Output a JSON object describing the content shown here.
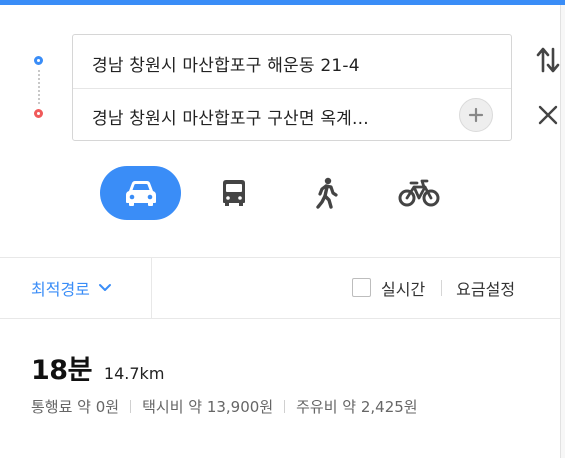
{
  "route": {
    "origin": "경남 창원시 마산합포구 해운동 21-4",
    "destination": "경남 창원시 마산합포구 구산면 옥계..."
  },
  "modes": [
    {
      "name": "car",
      "icon": "car-icon",
      "active": true
    },
    {
      "name": "bus",
      "icon": "bus-icon",
      "active": false
    },
    {
      "name": "walk",
      "icon": "walk-icon",
      "active": false
    },
    {
      "name": "bike",
      "icon": "bike-icon",
      "active": false
    }
  ],
  "options": {
    "route_preference": "최적경로",
    "realtime_label": "실시간",
    "fare_setting_label": "요금설정"
  },
  "result": {
    "duration": "18분",
    "distance": "14.7km",
    "toll": "통행료 약 0원",
    "taxi": "택시비 약 13,900원",
    "fuel": "주유비 약 2,425원"
  },
  "colors": {
    "accent": "#3a8df7",
    "destination": "#f05a5a",
    "icon_gray": "#444444"
  }
}
